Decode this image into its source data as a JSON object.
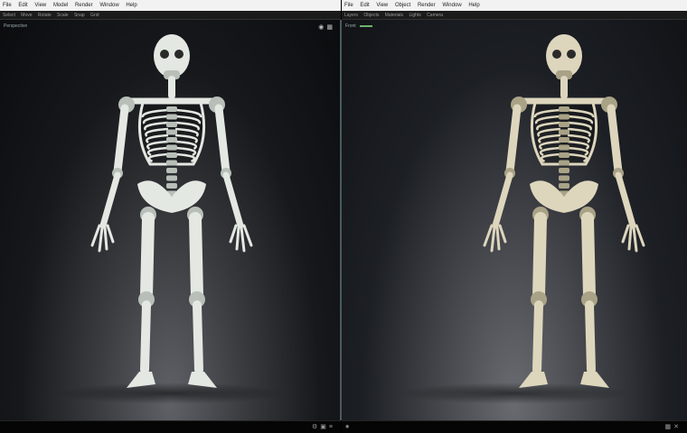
{
  "left_window": {
    "menu": [
      "File",
      "Edit",
      "View",
      "Model",
      "Render",
      "Window",
      "Help"
    ],
    "toolbar": [
      "Select",
      "Move",
      "Rotate",
      "Scale",
      "Snap",
      "Grid"
    ],
    "viewport_label": "Perspective",
    "status_text": "",
    "colors": {
      "bone": "#e3e8e2",
      "bone_shade": "#b8bfb8",
      "accent": "#6fb36f"
    }
  },
  "right_window": {
    "menu": [
      "File",
      "Edit",
      "View",
      "Object",
      "Render",
      "Window",
      "Help"
    ],
    "toolbar": [
      "Layers",
      "Objects",
      "Materials",
      "Lights",
      "Camera"
    ],
    "viewport_label": "Front",
    "status_chip": "",
    "status_fields": [
      "",
      ""
    ],
    "colors": {
      "bone": "#ddd6bd",
      "bone_shade": "#a9a286",
      "accent": "#6fb36f"
    }
  }
}
